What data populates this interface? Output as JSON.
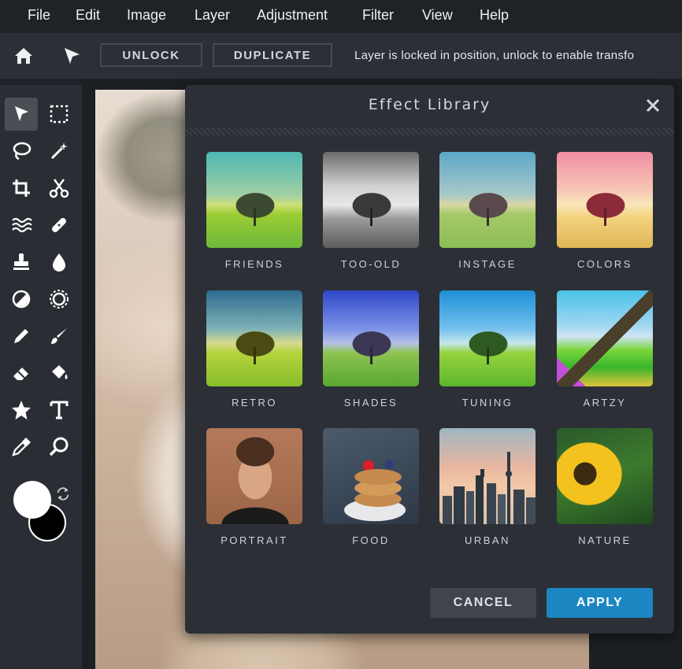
{
  "menu": [
    "File",
    "Edit",
    "Image",
    "Layer",
    "Adjustment",
    "Filter",
    "View",
    "Help"
  ],
  "toolbar": {
    "unlock_label": "UNLOCK",
    "duplicate_label": "DUPLICATE",
    "message": "Layer is locked in position, unlock to enable transfo"
  },
  "tools": [
    "move-tool",
    "marquee-tool",
    "lasso-tool",
    "magic-wand-tool",
    "crop-tool",
    "cut-tool",
    "liquify-tool",
    "heal-tool",
    "clone-stamp-tool",
    "blur-tool",
    "dodge-burn-tool",
    "sponge-tool",
    "pencil-tool",
    "brush-tool",
    "eraser-tool",
    "fill-tool",
    "shape-tool",
    "text-tool",
    "color-picker-tool",
    "zoom-tool"
  ],
  "colors": {
    "primary": "#ffffff",
    "secondary": "#000000",
    "accent": "#1b86c2"
  },
  "dialog": {
    "title": "Effect Library",
    "effects": [
      "FRIENDS",
      "TOO-OLD",
      "INSTAGE",
      "COLORS",
      "RETRO",
      "SHADES",
      "TUNING",
      "ARTZY",
      "PORTRAIT",
      "FOOD",
      "URBAN",
      "NATURE"
    ],
    "cancel_label": "CANCEL",
    "apply_label": "APPLY"
  }
}
